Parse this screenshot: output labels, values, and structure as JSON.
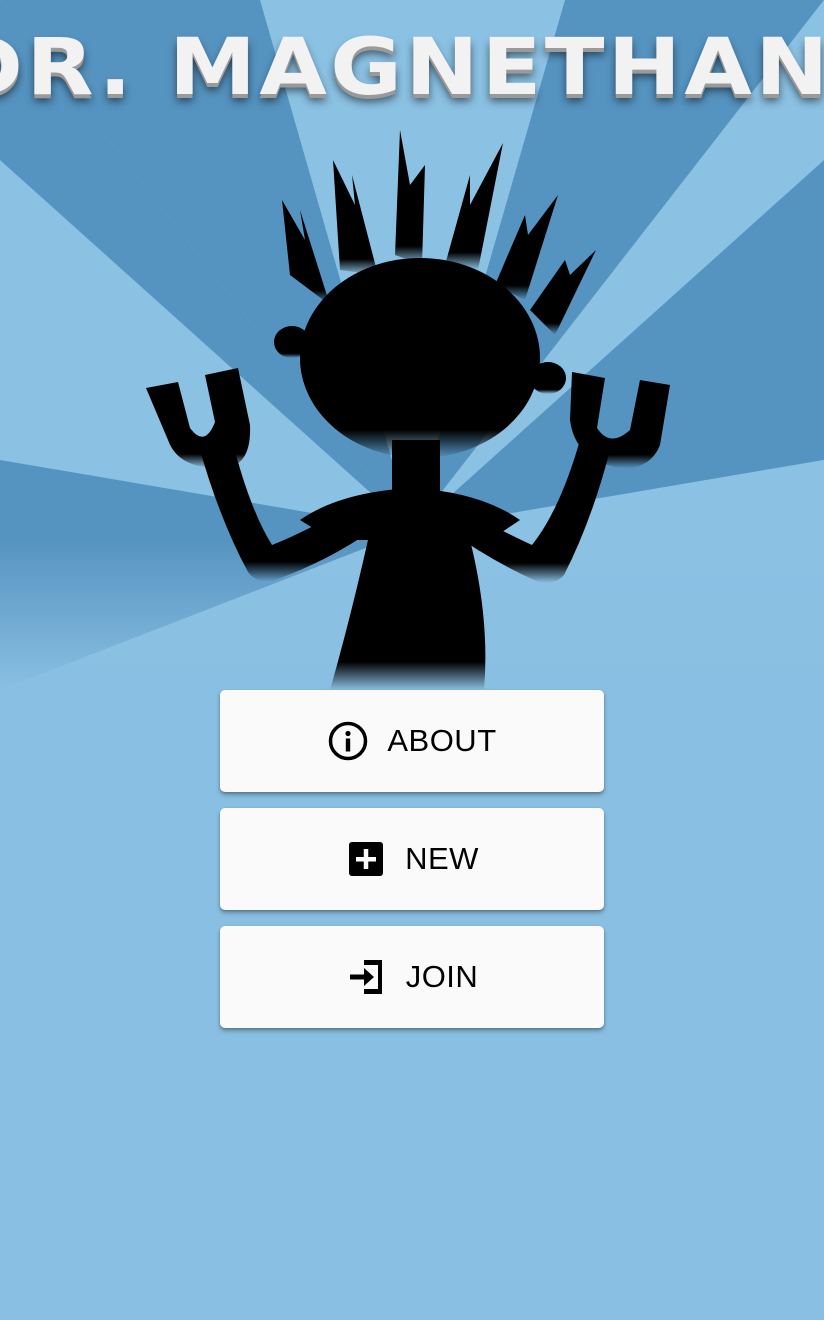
{
  "app": {
    "title": "DR. MAGNETHANDS"
  },
  "menu": {
    "items": [
      {
        "id": "about",
        "label": "ABOUT",
        "icon": "info-circle-icon"
      },
      {
        "id": "new",
        "label": "NEW",
        "icon": "plus-square-icon"
      },
      {
        "id": "join",
        "label": "JOIN",
        "icon": "login-enter-icon"
      }
    ]
  },
  "colors": {
    "background": "#89bfe2",
    "ray_light": "#8bc1e3",
    "ray_dark": "#5593c0",
    "button": "#fafafa",
    "silhouette": "#000000",
    "text": "#000000"
  }
}
